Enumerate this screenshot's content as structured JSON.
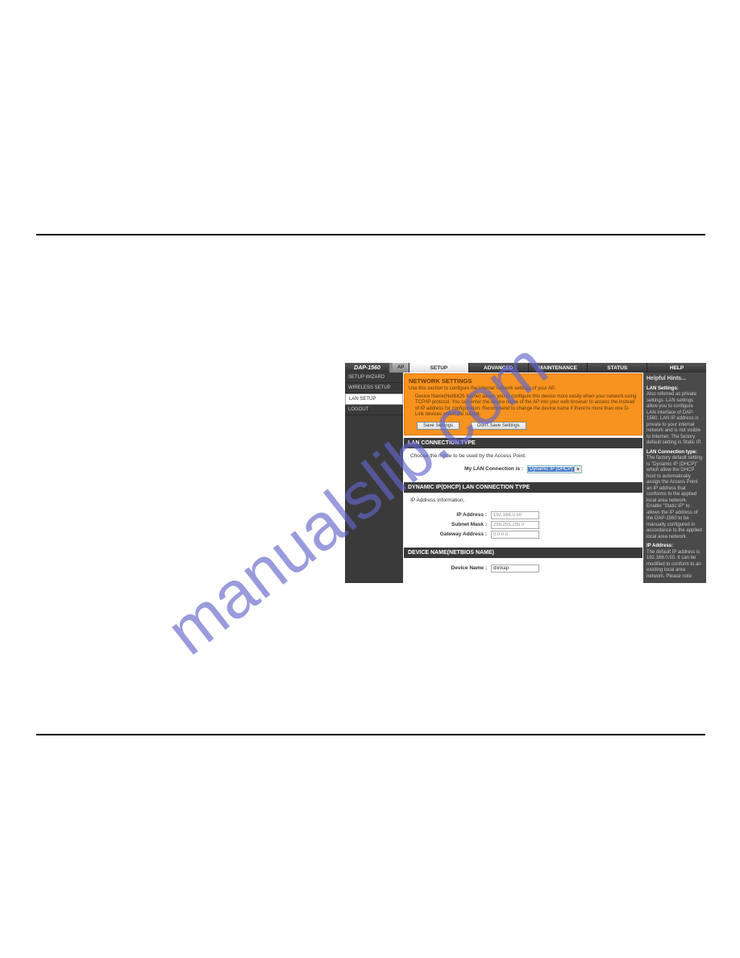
{
  "product": "DAP-1560",
  "mode": "AP",
  "tabs": {
    "setup": "SETUP",
    "advanced": "ADVANCED",
    "maintenance": "MAINTENANCE",
    "status": "STATUS",
    "help": "HELP"
  },
  "sidebar": {
    "items": [
      "SETUP WIZARD",
      "WIRELESS SETUP",
      "LAN SETUP",
      "LOGOUT"
    ]
  },
  "network_settings": {
    "title": "NETWORK SETTINGS",
    "desc1": "Use this section to configure the internal network settings of your AP.",
    "desc2": "Device Name(NetBIOS Name) allows you to configure this device more easily when your network using TCP/IP protocol. You can enter the device name of the AP into your web browser to access the instead of IP address for configuration. Recommend to change the device name if there're more than one D-Link devices within the subnet.",
    "save": "Save Settings",
    "dont_save": "Don't Save Settings"
  },
  "lan_conn": {
    "title": "LAN CONNECTION TYPE",
    "desc": "Choose the mode to be used by the Access Point.",
    "label": "My LAN Connection is :",
    "value": "Dynamic IP (DHCP)"
  },
  "dhcp": {
    "title": "DYNAMIC IP(DHCP) LAN CONNECTION TYPE",
    "desc": "IP Address Information.",
    "ip_label": "IP Address :",
    "ip_value": "192.168.0.50",
    "mask_label": "Subnet Mask :",
    "mask_value": "255.255.255.0",
    "gw_label": "Gateway Address :",
    "gw_value": "0.0.0.0"
  },
  "devname": {
    "title": "DEVICE NAME(NETBIOS NAME)",
    "label": "Device Name :",
    "value": "dlinkap"
  },
  "hints": {
    "title": "Helpful Hints...",
    "h1": "LAN Settings:",
    "t1": "Also referred as private settings. LAN settings allow you to configure LAN interface of DAP-1560. LAN IP address is private to your internal network and is not visible to Internet. The factory default setting is Static IP.",
    "h2": "LAN Connection type:",
    "t2": "The factory default setting is \"Dynamic IP (DHCP)\" which allow the DHCP host to automatically assign the Access Point an IP address that conforms to the applied local area network. Enable \"Static IP\" to allows the IP address of the DAP-1560 to be manually configured in accordance to the applied local area network.",
    "h3": "IP Address:",
    "t3": "The default IP address is 192.168.0.50. It can be modified to conform to an existing local area network. Please note"
  }
}
